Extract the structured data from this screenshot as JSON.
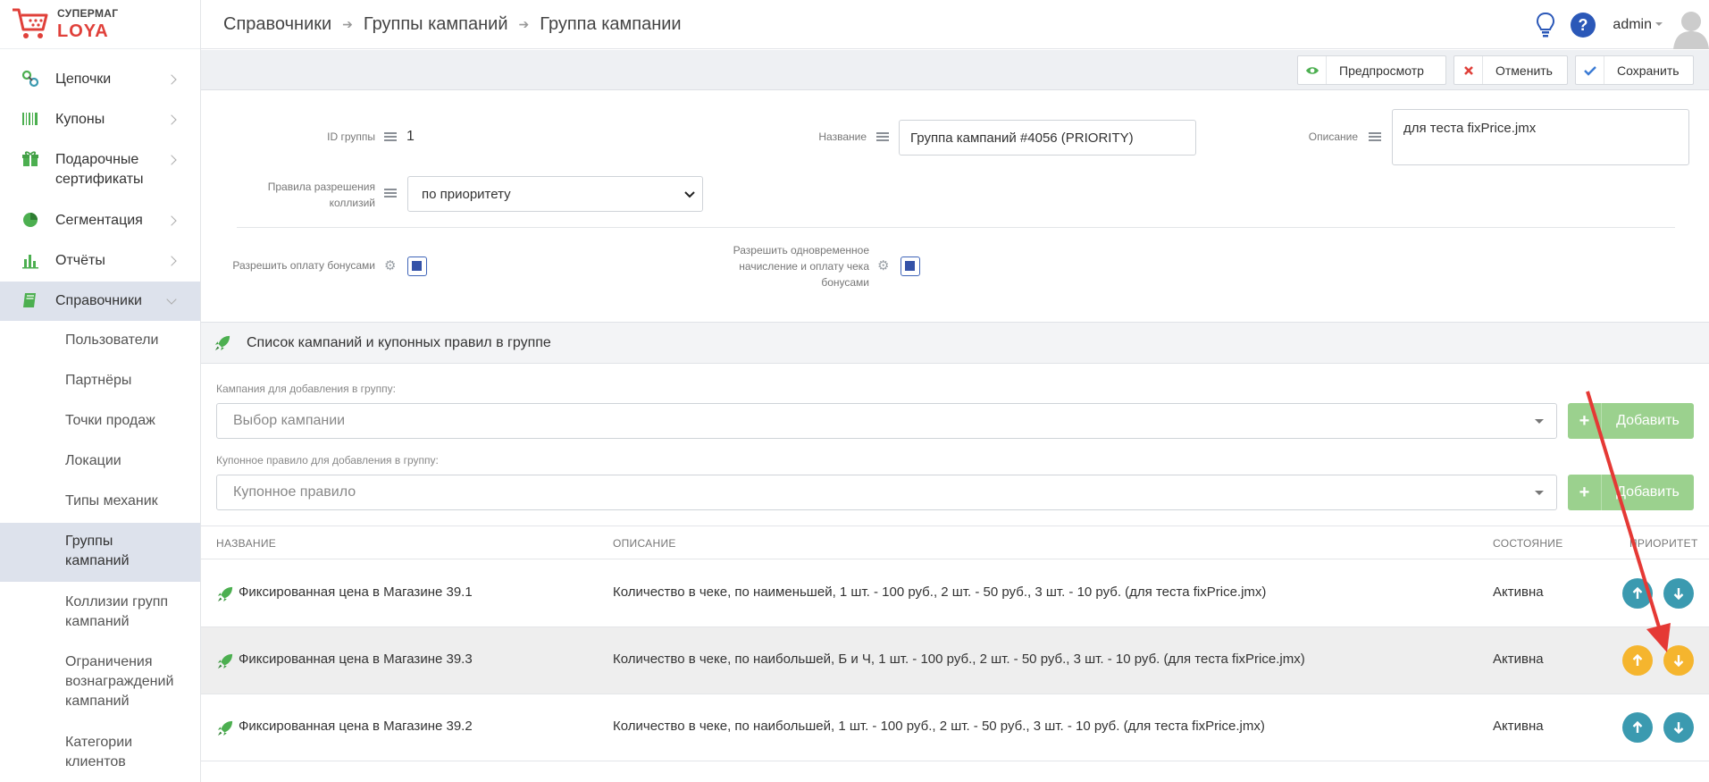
{
  "logo": {
    "top": "СУПЕРМАГ",
    "bottom": "LOYA"
  },
  "sidebar": {
    "items": [
      {
        "label": "Цепочки",
        "icon": "chain-icon"
      },
      {
        "label": "Купоны",
        "icon": "barcode-icon"
      },
      {
        "label": "Подарочные сертификаты",
        "icon": "gift-icon"
      },
      {
        "label": "Сегментация",
        "icon": "pie-chart-icon"
      },
      {
        "label": "Отчёты",
        "icon": "bar-chart-icon"
      },
      {
        "label": "Справочники",
        "icon": "book-icon"
      }
    ],
    "sub_items": [
      "Пользователи",
      "Партнёры",
      "Точки продаж",
      "Локации",
      "Типы механик",
      "Группы кампаний",
      "Коллизии групп кампаний",
      "Ограничения вознаграждений кампаний",
      "Категории клиентов"
    ]
  },
  "header": {
    "breadcrumbs": [
      "Справочники",
      "Группы кампаний",
      "Группа кампании"
    ],
    "user": "admin"
  },
  "toolbar": {
    "preview": "Предпросмотр",
    "cancel": "Отменить",
    "save": "Сохранить"
  },
  "form": {
    "id_label": "ID группы",
    "id_value": "1",
    "name_label": "Название",
    "name_value": "Группа кампаний #4056 (PRIORITY)",
    "desc_label": "Описание",
    "desc_value": "для теста fixPrice.jmx",
    "collision_label": "Правила разрешения коллизий",
    "collision_value": "по приоритету",
    "allow_bonus_label": "Разрешить оплату бонусами",
    "allow_bonus_checked": true,
    "allow_simul_label": "Разрешить одновременное начисление и оплату чека бонусами",
    "allow_simul_checked": true
  },
  "section": {
    "title": "Список кампаний и купонных правил в группе",
    "campaign_label": "Кампания для добавления в группу:",
    "campaign_placeholder": "Выбор кампании",
    "coupon_label": "Купонное правило для добавления в группу:",
    "coupon_placeholder": "Купонное правило",
    "add_label": "Добавить"
  },
  "table": {
    "headers": [
      "НАЗВАНИЕ",
      "ОПИСАНИЕ",
      "СОСТОЯНИЕ",
      "ПРИОРИТЕТ"
    ],
    "rows": [
      {
        "name": "Фиксированная цена в Магазине 39.1",
        "desc": "Количество в чеке, по наименьшей, 1 шт. - 100 руб., 2 шт. - 50 руб., 3 шт. - 10 руб. (для теста fixPrice.jmx)",
        "status": "Активна"
      },
      {
        "name": "Фиксированная цена в Магазине 39.3",
        "desc": "Количество в чеке, по наибольшей, Б и Ч, 1 шт. - 100 руб., 2 шт. - 50 руб., 3 шт. - 10 руб. (для теста fixPrice.jmx)",
        "status": "Активна"
      },
      {
        "name": "Фиксированная цена в Магазине 39.2",
        "desc": "Количество в чеке, по наибольшей, 1 шт. - 100 руб., 2 шт. - 50 руб., 3 шт. - 10 руб. (для теста fixPrice.jmx)",
        "status": "Активна"
      }
    ]
  },
  "colors": {
    "accent_green": "#4caf50",
    "add_button": "#9bd18e",
    "priority_teal": "#3b9ab0",
    "priority_amber": "#f5b52e",
    "arrow_red": "#e53935",
    "active_nav": "#dde2ec"
  }
}
